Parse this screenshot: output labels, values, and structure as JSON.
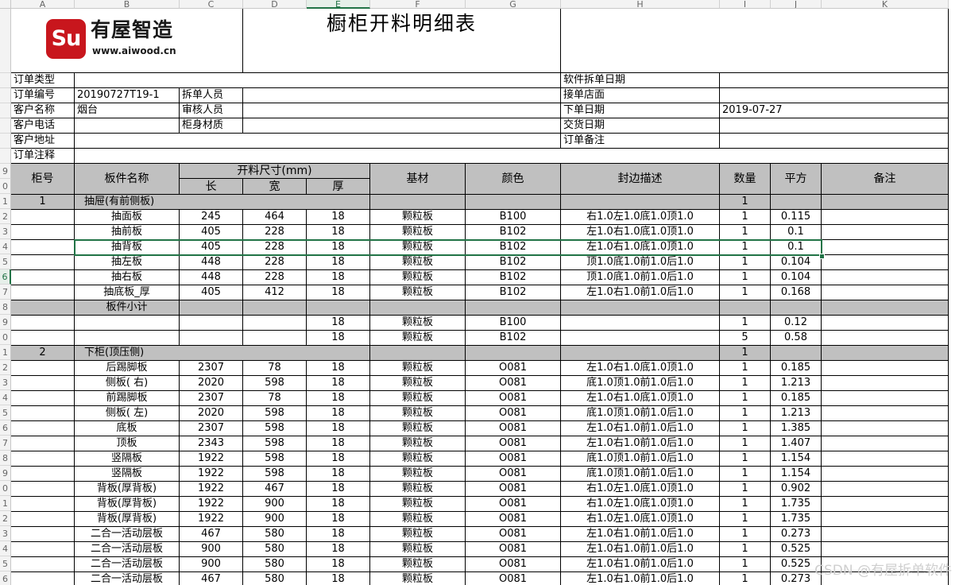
{
  "sheet": {
    "col_letters": [
      "A",
      "B",
      "C",
      "D",
      "E",
      "F",
      "G",
      "H",
      "I",
      "J",
      "K"
    ],
    "selected_col": "E",
    "selected_row_index": 14,
    "row_numbers": [
      "",
      "",
      "",
      "",
      "",
      "7",
      "8",
      "9",
      "0",
      "1",
      "2",
      "3",
      "4",
      "5",
      "6",
      "7",
      "8",
      "9",
      "0",
      "1",
      "2",
      "3",
      "4",
      "5",
      "6",
      "7",
      "8",
      "9",
      "0",
      "1",
      "2",
      "3",
      "4",
      "5",
      "6"
    ]
  },
  "header": {
    "logo_badge": "Su",
    "logo_name": "有屋智造",
    "logo_url": "www.aiwood.cn",
    "title": "橱柜开料明细表"
  },
  "order": {
    "labels": {
      "type": "订单类型",
      "number": "订单编号",
      "customer": "客户名称",
      "phone": "客户电话",
      "address": "客户地址",
      "note": "订单注释",
      "split_person": "拆单人员",
      "reviewer": "审核人员",
      "material": "柜身材质",
      "split_date": "软件拆单日期",
      "store": "接单店面",
      "order_date": "下单日期",
      "delivery_date": "交货日期",
      "remark": "订单备注"
    },
    "values": {
      "number": "20190727T19-1",
      "customer": "烟台",
      "order_date": "2019-07-27"
    }
  },
  "table": {
    "headers": {
      "cabinet_no": "柜号",
      "part_name": "板件名称",
      "cut_size": "开料尺寸(mm)",
      "length": "长",
      "width": "宽",
      "thickness": "厚",
      "material": "基材",
      "color": "颜色",
      "edge": "封边描述",
      "qty": "数量",
      "area": "平方",
      "note": "备注"
    },
    "rows": [
      {
        "group": true,
        "no": "1",
        "name": "抽屉(有前侧板)",
        "qty": "1"
      },
      {
        "name": "抽面板",
        "l": "245",
        "w": "464",
        "t": "18",
        "m": "颗粒板",
        "c": "B100",
        "e": "右1.0左1.0底1.0顶1.0",
        "q": "1",
        "a": "0.115"
      },
      {
        "name": "抽前板",
        "l": "405",
        "w": "228",
        "t": "18",
        "m": "颗粒板",
        "c": "B102",
        "e": "左1.0右1.0底1.0顶1.0",
        "q": "1",
        "a": "0.1"
      },
      {
        "name": "抽背板",
        "l": "405",
        "w": "228",
        "t": "18",
        "m": "颗粒板",
        "c": "B102",
        "e": "左1.0右1.0底1.0顶1.0",
        "q": "1",
        "a": "0.1"
      },
      {
        "name": "抽左板",
        "l": "448",
        "w": "228",
        "t": "18",
        "m": "颗粒板",
        "c": "B102",
        "e": "顶1.0底1.0前1.0后1.0",
        "q": "1",
        "a": "0.104"
      },
      {
        "name": "抽右板",
        "l": "448",
        "w": "228",
        "t": "18",
        "m": "颗粒板",
        "c": "B102",
        "e": "顶1.0底1.0前1.0后1.0",
        "q": "1",
        "a": "0.104"
      },
      {
        "name": "抽底板_厚",
        "l": "405",
        "w": "412",
        "t": "18",
        "m": "颗粒板",
        "c": "B102",
        "e": "左1.0右1.0前1.0后1.0",
        "q": "1",
        "a": "0.168"
      },
      {
        "subtotal": true,
        "name": "板件小计"
      },
      {
        "name": "",
        "l": "",
        "w": "",
        "t": "18",
        "m": "颗粒板",
        "c": "B100",
        "e": "",
        "q": "1",
        "a": "0.12"
      },
      {
        "name": "",
        "l": "",
        "w": "",
        "t": "18",
        "m": "颗粒板",
        "c": "B102",
        "e": "",
        "q": "5",
        "a": "0.58"
      },
      {
        "group": true,
        "no": "2",
        "name": "下柜(顶压侧)",
        "qty": "1"
      },
      {
        "name": "后踢脚板",
        "l": "2307",
        "w": "78",
        "t": "18",
        "m": "颗粒板",
        "c": "O081",
        "e": "左1.0右1.0底1.0顶1.0",
        "q": "1",
        "a": "0.185"
      },
      {
        "name": "侧板( 右)",
        "l": "2020",
        "w": "598",
        "t": "18",
        "m": "颗粒板",
        "c": "O081",
        "e": "底1.0顶1.0前1.0后1.0",
        "q": "1",
        "a": "1.213"
      },
      {
        "name": "前踢脚板",
        "l": "2307",
        "w": "78",
        "t": "18",
        "m": "颗粒板",
        "c": "O081",
        "e": "左1.0右1.0底1.0顶1.0",
        "q": "1",
        "a": "0.185"
      },
      {
        "name": "侧板( 左)",
        "l": "2020",
        "w": "598",
        "t": "18",
        "m": "颗粒板",
        "c": "O081",
        "e": "底1.0顶1.0前1.0后1.0",
        "q": "1",
        "a": "1.213"
      },
      {
        "name": "底板",
        "l": "2307",
        "w": "598",
        "t": "18",
        "m": "颗粒板",
        "c": "O081",
        "e": "左1.0右1.0前1.0后1.0",
        "q": "1",
        "a": "1.385"
      },
      {
        "name": "顶板",
        "l": "2343",
        "w": "598",
        "t": "18",
        "m": "颗粒板",
        "c": "O081",
        "e": "左1.0右1.0前1.0后1.0",
        "q": "1",
        "a": "1.407"
      },
      {
        "name": "竖隔板",
        "l": "1922",
        "w": "598",
        "t": "18",
        "m": "颗粒板",
        "c": "O081",
        "e": "底1.0顶1.0前1.0后1.0",
        "q": "1",
        "a": "1.154"
      },
      {
        "name": "竖隔板",
        "l": "1922",
        "w": "598",
        "t": "18",
        "m": "颗粒板",
        "c": "O081",
        "e": "底1.0顶1.0前1.0后1.0",
        "q": "1",
        "a": "1.154"
      },
      {
        "name": "背板(厚背板)",
        "l": "1922",
        "w": "467",
        "t": "18",
        "m": "颗粒板",
        "c": "O081",
        "e": "右1.0左1.0底1.0顶1.0",
        "q": "1",
        "a": "0.902"
      },
      {
        "name": "背板(厚背板)",
        "l": "1922",
        "w": "900",
        "t": "18",
        "m": "颗粒板",
        "c": "O081",
        "e": "右1.0左1.0底1.0顶1.0",
        "q": "1",
        "a": "1.735"
      },
      {
        "name": "背板(厚背板)",
        "l": "1922",
        "w": "900",
        "t": "18",
        "m": "颗粒板",
        "c": "O081",
        "e": "右1.0左1.0底1.0顶1.0",
        "q": "1",
        "a": "1.735"
      },
      {
        "name": "二合一活动层板",
        "l": "467",
        "w": "580",
        "t": "18",
        "m": "颗粒板",
        "c": "O081",
        "e": "左1.0右1.0前1.0后1.0",
        "q": "1",
        "a": "0.273"
      },
      {
        "name": "二合一活动层板",
        "l": "900",
        "w": "580",
        "t": "18",
        "m": "颗粒板",
        "c": "O081",
        "e": "左1.0右1.0前1.0后1.0",
        "q": "1",
        "a": "0.525"
      },
      {
        "name": "二合一活动层板",
        "l": "900",
        "w": "580",
        "t": "18",
        "m": "颗粒板",
        "c": "O081",
        "e": "左1.0右1.0前1.0后1.0",
        "q": "1",
        "a": "0.525"
      },
      {
        "name": "二合一活动层板",
        "l": "467",
        "w": "580",
        "t": "18",
        "m": "颗粒板",
        "c": "O081",
        "e": "左1.0右1.0前1.0后1.0",
        "q": "1",
        "a": "0.273"
      }
    ]
  },
  "watermark": "CSDN @有屋拆单软件"
}
